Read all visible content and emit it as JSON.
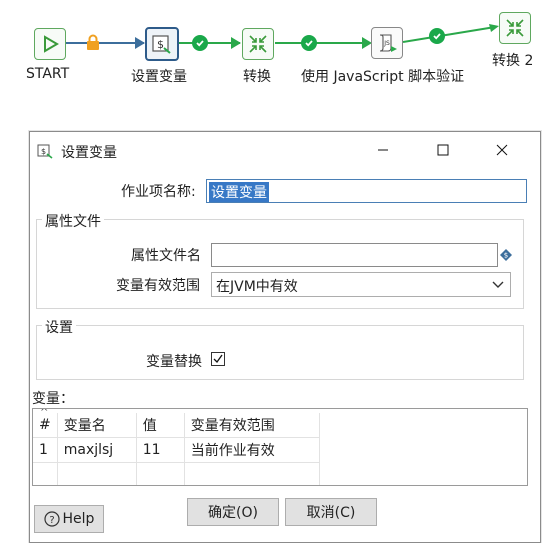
{
  "workflow": {
    "nodes": [
      {
        "label": "START",
        "icon": "start-icon"
      },
      {
        "label": "设置变量",
        "icon": "set-variables-icon"
      },
      {
        "label": "转换",
        "icon": "transformation-icon"
      },
      {
        "label": "使用 JavaScript 脚本验证",
        "icon": "javascript-icon"
      },
      {
        "label": "转换 2",
        "icon": "transformation-icon"
      }
    ]
  },
  "dialog": {
    "title": "设置变量",
    "job_entry_name_label": "作业项名称:",
    "job_entry_name_value": "设置变量",
    "properties_group_title": "属性文件",
    "properties_filename_label": "属性文件名",
    "properties_filename_value": "",
    "variable_scope_label": "变量有效范围",
    "variable_scope_value": "在JVM中有效",
    "settings_group_title": "设置",
    "variable_replace_label": "变量替换",
    "variable_replace_checked": true,
    "variables_label": "变量：",
    "table": {
      "sort_indicator": "^",
      "headers": [
        "#",
        "变量名",
        "值",
        "变量有效范围"
      ],
      "rows": [
        [
          "1",
          "maxjlsj",
          "11",
          "当前作业有效"
        ]
      ]
    },
    "ok_button": "确定(O)",
    "cancel_button": "取消(C)",
    "help_button": "Help"
  }
}
